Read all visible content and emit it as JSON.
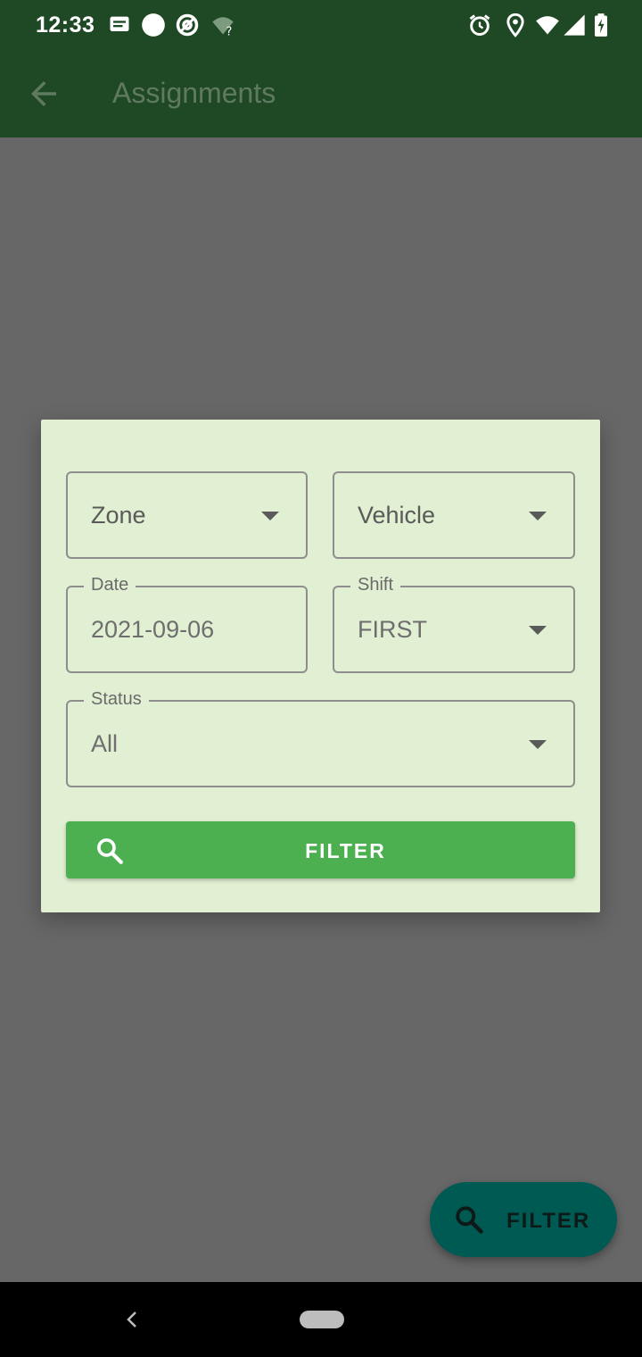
{
  "status_bar": {
    "time": "12:33",
    "icons": [
      "message-icon",
      "circle-icon",
      "at-icon",
      "wifi-question-icon",
      "alarm-icon",
      "location-icon",
      "wifi-icon",
      "signal-icon",
      "battery-icon"
    ]
  },
  "app_bar": {
    "title": "Assignments",
    "back_icon": "arrow-back-icon"
  },
  "filter_dialog": {
    "zone": {
      "placeholder": "Zone"
    },
    "vehicle": {
      "placeholder": "Vehicle"
    },
    "date": {
      "label": "Date",
      "value": "2021-09-06"
    },
    "shift": {
      "label": "Shift",
      "value": "FIRST"
    },
    "status": {
      "label": "Status",
      "value": "All"
    },
    "filter_button": {
      "label": "FILTER",
      "icon": "search-icon"
    }
  },
  "fab": {
    "label": "FILTER",
    "icon": "search-icon"
  },
  "colors": {
    "app_bar": "#1f4924",
    "scrim": "#676767",
    "dialog_bg": "#e1efd2",
    "primary_button": "#4caf50",
    "fab": "#005a54"
  }
}
